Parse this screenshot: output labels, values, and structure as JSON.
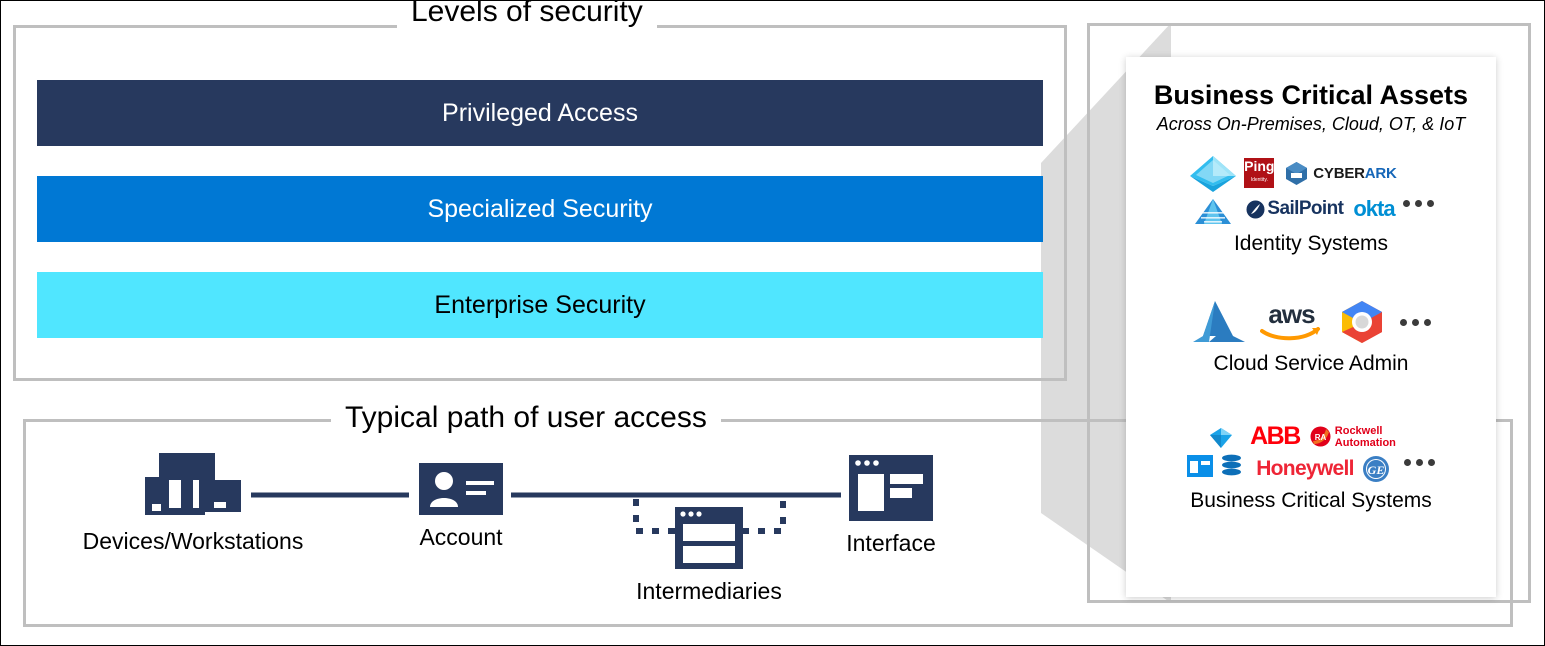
{
  "panels": {
    "levels": {
      "title": "Levels of security",
      "bars": [
        {
          "label": "Privileged Access",
          "color": "#27395E",
          "text_color": "#ffffff"
        },
        {
          "label": "Specialized Security",
          "color": "#0078D4",
          "text_color": "#ffffff"
        },
        {
          "label": "Enterprise Security",
          "color": "#50E6FF",
          "text_color": "#000000"
        }
      ]
    },
    "path": {
      "title": "Typical path of user access",
      "nodes": [
        {
          "label": "Devices/Workstations",
          "icon": "devices-workstations-icon"
        },
        {
          "label": "Account",
          "icon": "account-card-icon"
        },
        {
          "label": "Intermediaries",
          "icon": "intermediaries-window-icon"
        },
        {
          "label": "Interface",
          "icon": "interface-window-icon"
        }
      ]
    },
    "assets": {
      "title": "Business Critical Assets",
      "subtitle": "Across On-Premises, Cloud, OT, & IoT",
      "groups": [
        {
          "label": "Identity Systems",
          "logos": [
            "active-directory-icon",
            "ping-identity-logo",
            "cyberark-logo",
            "azure-ad-pyramid-icon",
            "sailpoint-logo",
            "okta-logo"
          ],
          "ellipsis": "…"
        },
        {
          "label": "Cloud Service Admin",
          "logos": [
            "azure-logo",
            "aws-logo",
            "google-cloud-logo"
          ],
          "ellipsis": "…"
        },
        {
          "label": "Business Critical Systems",
          "logos": [
            "sap-diamond-logo",
            "abb-logo",
            "rockwell-automation-logo",
            "window-app-icon",
            "database-icon",
            "honeywell-logo",
            "ge-logo"
          ],
          "ellipsis": "…"
        }
      ]
    }
  },
  "logo_text": {
    "cyberark_1": "CYBER",
    "cyberark_2": "ARK",
    "cyberark_tm": "®",
    "sailpoint": "SailPoint",
    "okta": "okta",
    "aws": "aws",
    "abb": "ABB",
    "rockwell_1": "Rockwell",
    "rockwell_2": "Automation",
    "rockwell_mark": "RA",
    "honeywell": "Honeywell",
    "ge": "GE",
    "ping_1": "Ping",
    "ping_2": "Identity."
  },
  "colors": {
    "level_dark": "#27395E",
    "level_mid": "#0078D4",
    "level_light": "#50E6FF",
    "panel_border": "#bfbfbf",
    "funnel_gray": "#dcdcdc",
    "icon_navy": "#27395E"
  }
}
